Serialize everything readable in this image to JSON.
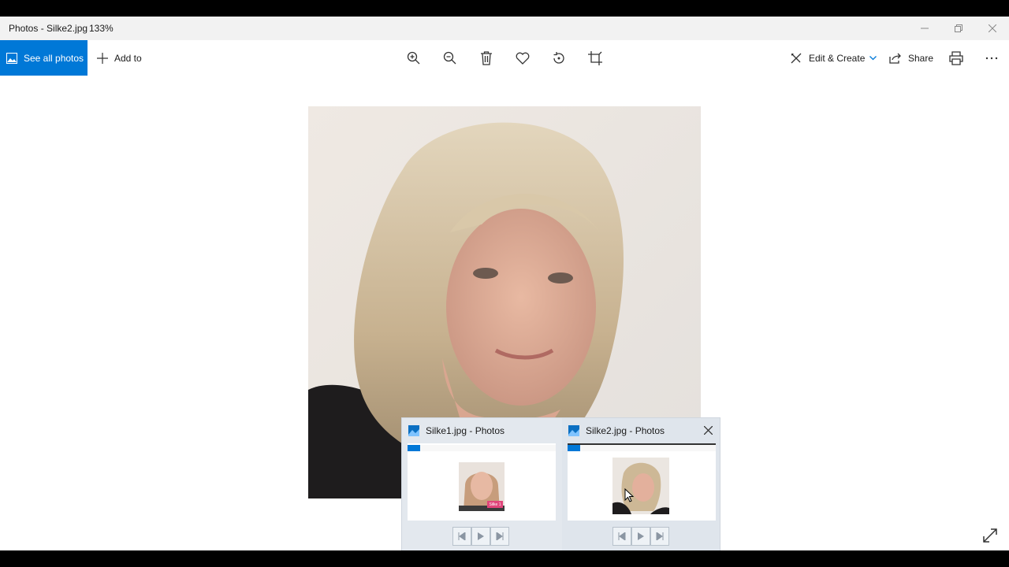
{
  "window": {
    "title": "Photos - Silke2.jpg",
    "zoom": "133%"
  },
  "toolbar": {
    "see_all_photos": "See all photos",
    "add_to": "Add to",
    "tools": [
      "zoom-in-icon",
      "zoom-out-icon",
      "delete-icon",
      "favorite-icon",
      "rotate-icon",
      "crop-icon"
    ],
    "edit_create": "Edit & Create",
    "share": "Share"
  },
  "taskbar_preview": {
    "windows": [
      {
        "title": "Silke1.jpg - Photos",
        "badge": "Silke 1"
      },
      {
        "title": "Silke2.jpg - Photos"
      }
    ]
  },
  "colors": {
    "accent": "#0078d7",
    "titlebar": "#f2f2f2",
    "preview_bg": "#e3e8ee",
    "badge": "#e0457b"
  }
}
